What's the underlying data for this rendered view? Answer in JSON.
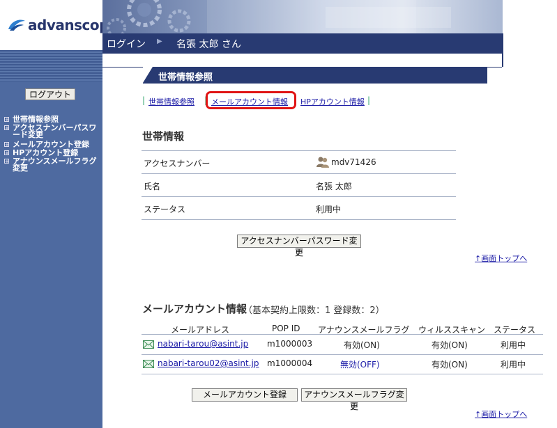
{
  "brand": {
    "logo_text": "advanscope"
  },
  "navbar": {
    "login": "ログイン",
    "user": "名張 太郎 さん"
  },
  "sidebar": {
    "logout_label": "ログアウト",
    "items": [
      {
        "label": "世帯情報参照"
      },
      {
        "label": "アクセスナンバーパスワード変更"
      },
      {
        "label": "メールアカウント登録"
      },
      {
        "label": "HPアカウント登録"
      },
      {
        "label": "アナウンスメールフラグ変更"
      }
    ]
  },
  "page": {
    "title": "世帯情報参照",
    "tabs": [
      {
        "label": "世帯情報参照"
      },
      {
        "label": "メールアカウント情報"
      },
      {
        "label": "HPアカウント情報"
      }
    ]
  },
  "household": {
    "heading": "世帯情報",
    "rows": [
      {
        "key": "アクセスナンバー",
        "value": "mdv71426"
      },
      {
        "key": "氏名",
        "value": "名張 太郎"
      },
      {
        "key": "ステータス",
        "value": "利用中"
      }
    ],
    "password_button": "アクセスナンバーパスワード変更",
    "top_link": "↑画面トップへ"
  },
  "mail": {
    "heading": "メールアカウント情報",
    "summary": "（基本契約上限数：1 登録数：2）",
    "columns": [
      "メールアドレス",
      "POP ID",
      "アナウンスメールフラグ",
      "ウィルススキャン",
      "ステータス"
    ],
    "rows": [
      {
        "address": "nabari-tarou@asint.jp",
        "pop_id": "m1000003",
        "announce": "有効(ON)",
        "virus": "有効(ON)",
        "status": "利用中"
      },
      {
        "address": "nabari-tarou02@asint.jp",
        "pop_id": "m1000004",
        "announce": "無効(OFF)",
        "virus": "有効(ON)",
        "status": "利用中"
      }
    ],
    "register_button": "メールアカウント登録",
    "flag_button": "アナウンスメールフラグ変更",
    "top_link": "↑画面トップへ"
  },
  "colors": {
    "nav": "#283a72",
    "sidebar": "#4e6aa0",
    "link": "#1a1aa6",
    "highlight": "#e01414",
    "announce_off": "#2222aa"
  }
}
